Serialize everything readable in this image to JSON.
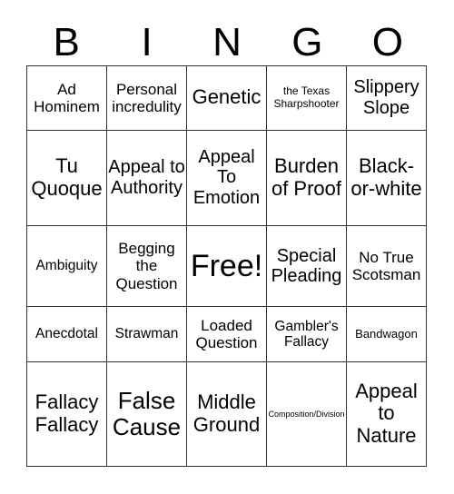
{
  "card": {
    "header": [
      "B",
      "I",
      "N",
      "G",
      "O"
    ],
    "rows": [
      [
        "Ad Hominem",
        "Personal incredulity",
        "Genetic",
        "the Texas Sharpshooter",
        "Slippery Slope"
      ],
      [
        "Tu Quoque",
        "Appeal to Authority",
        "Appeal To Emotion",
        "Burden of Proof",
        "Black-or-white"
      ],
      [
        "Ambiguity",
        "Begging the Question",
        "Free!",
        "Special Pleading",
        "No True Scotsman"
      ],
      [
        "Anecdotal",
        "Strawman",
        "Loaded Question",
        "Gambler's Fallacy",
        "Bandwagon"
      ],
      [
        "Fallacy Fallacy",
        "False Cause",
        "Middle Ground",
        "Composition/Division",
        "Appeal to Nature"
      ]
    ],
    "free_space": {
      "row": 2,
      "col": 2,
      "label": "Free!"
    }
  }
}
